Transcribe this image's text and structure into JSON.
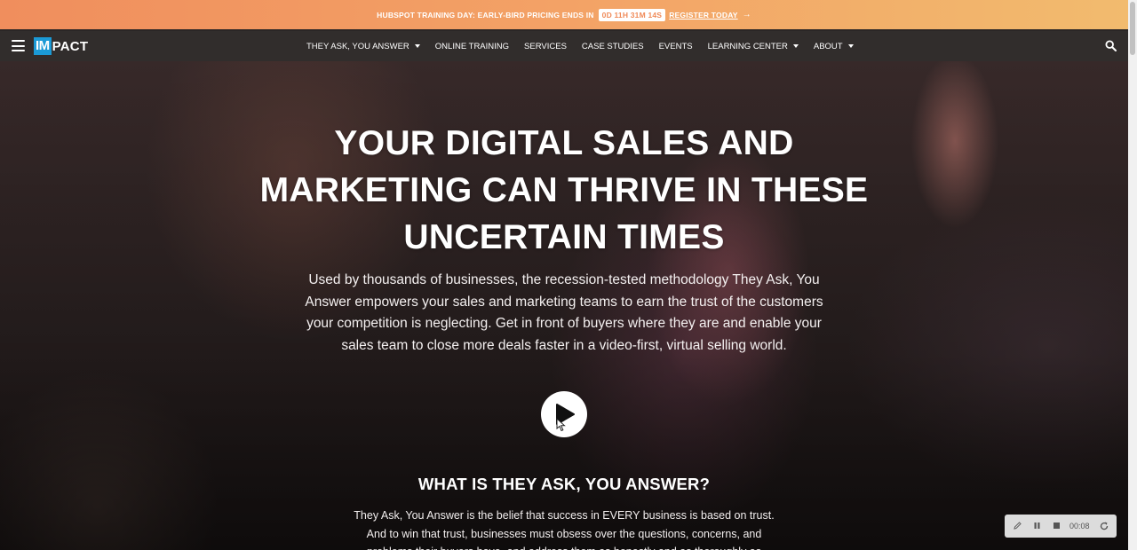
{
  "promo": {
    "text": "HUBSPOT TRAINING DAY: EARLY-BIRD PRICING ENDS IN",
    "timer": "0D 11H 31M 14S",
    "cta": "REGISTER TODAY",
    "cta_icon": "arrow-right-icon"
  },
  "nav": {
    "logo_im": "IM",
    "logo_pact": "PACT",
    "items": [
      {
        "label": "THEY ASK, YOU ANSWER",
        "dropdown": true
      },
      {
        "label": "ONLINE TRAINING",
        "dropdown": false
      },
      {
        "label": "SERVICES",
        "dropdown": false
      },
      {
        "label": "CASE STUDIES",
        "dropdown": false
      },
      {
        "label": "EVENTS",
        "dropdown": false
      },
      {
        "label": "LEARNING CENTER",
        "dropdown": true
      },
      {
        "label": "ABOUT",
        "dropdown": true
      }
    ],
    "menu_icon": "hamburger-menu-icon",
    "search_icon": "search-icon"
  },
  "hero": {
    "headline_lines": [
      "YOUR DIGITAL SALES AND",
      "MARKETING CAN THRIVE IN THESE",
      "UNCERTAIN TIMES"
    ],
    "lead_lines": [
      "Used by thousands of businesses, the recession-tested methodology They Ask, You",
      "Answer empowers your sales and marketing teams to earn the trust of the customers",
      "your competition is neglecting. Get in front of buyers where they are and enable your",
      "sales team to close more deals faster in a video-first, virtual selling world."
    ],
    "play_icon": "play-icon",
    "subheading": "WHAT IS THEY ASK, YOU ANSWER?",
    "body_lines": [
      "They Ask, You Answer is the belief that success in EVERY business is based on trust.",
      "And to win that trust, businesses must obsess over the questions, concerns, and",
      "problems their buyers have, and address them as honestly and as thoroughly as"
    ]
  },
  "recorder": {
    "time": "00:08",
    "icons": [
      "pencil-icon",
      "pause-icon",
      "stop-icon",
      "restart-icon"
    ]
  },
  "colors": {
    "banner_start": "#f08e5d",
    "banner_end": "#f2bb6e",
    "nav_bg": "#312d2c",
    "logo_blue": "#1b9ad6"
  }
}
